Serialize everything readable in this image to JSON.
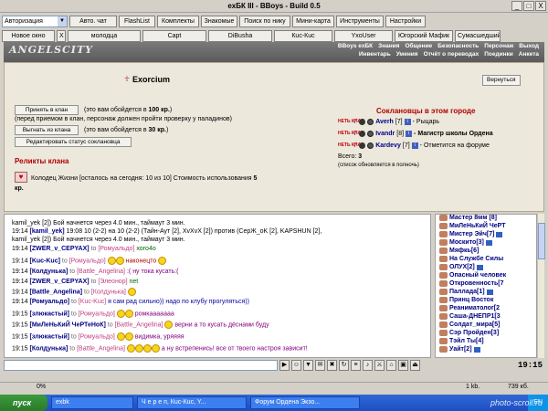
{
  "window": {
    "title": "exБК III - BBoys - Build 0.5",
    "btn_min": "_",
    "btn_max": "□",
    "btn_close": "X"
  },
  "toolbar1": {
    "dropdown_value": "Авторизация",
    "buttons": [
      "Авто. чат",
      "FlashList",
      "Комплекты",
      "Знакомые",
      "Поиск по нику",
      "Мини-карта",
      "Инструменты",
      "Настройки"
    ]
  },
  "toolbar2": {
    "new_window": "Новое окно",
    "close": "X",
    "tabs": [
      "молодца",
      "Capt",
      "DiBusha",
      "Кuc-Кuc",
      "YxoUser",
      "Югорский Мафик",
      "Сумасшедший"
    ]
  },
  "game_header": {
    "logo": "ANGELSCITY",
    "menu_row1": [
      "BBoys exБК",
      "Знания",
      "Общение",
      "Безопасность",
      "Персонаж",
      "Выход"
    ],
    "menu_row2": [
      "Инвентарь",
      "Умения",
      "Отчёт о переводах",
      "Поединки",
      "Анкета"
    ]
  },
  "clan": {
    "name": "Exorcium",
    "return_label": "Вернуться",
    "accept_button": "Принять в клан",
    "accept_cost_pre": "(это вам обойдется в ",
    "accept_cost": "100 кр.",
    "accept_cost_post": ")",
    "accept_note": "(перед приемом в клан, персонаж должен пройти проверку у паладинов)",
    "expel_button": "Выгнать из клана",
    "expel_cost_pre": "(это вам обойдется в ",
    "expel_cost": "30 кр.",
    "expel_cost_post": ")",
    "edit_status_button": "Редактировать статус соклановца",
    "relics_title": "Реликты клана",
    "relic_text": "Колодец Жизни [осталось на сегодня: 10 из 10] Стоимость использования ",
    "relic_cost": "5",
    "relic_cost_unit": "кр.",
    "members_title": "Соклановцы в этом городе",
    "badge_text": "НЕТЬ КЛАН",
    "members": [
      {
        "nick": "Averh",
        "level": "[7]",
        "status": "- Рыцарь"
      },
      {
        "nick": "Ivandr",
        "level": "[8]",
        "status": "- Магистр школы Ордена"
      },
      {
        "nick": "Kardevy",
        "level": "[7]",
        "status": "- Отметится на форуме"
      }
    ],
    "total_label": "Всего: ",
    "total_value": "3",
    "list_note": "(список обновляется в полночь)"
  },
  "chat": {
    "lines": [
      {
        "text": "kamil_yek [2]) Бой начнется через 4.0 мин., таймаут 3 мин."
      },
      {
        "time": "19:14",
        "nick": "[kamil_yek]",
        "text": "19:08 10 (2-2) на 10 (2-2) (Тайн-Аут [2], XvXvX [2]) против (СерЖ_oK [2], KAPSHUN [2],"
      },
      {
        "text": "kamil_yek [2]) Бой начнется через 4.0 мин., таймаут 3 мин."
      },
      {
        "time": "19:14",
        "nick": "[ZWER_v_CEPYAX]",
        "to": "to",
        "target": "[Ромуальдо]",
        "msg": "хого4о"
      },
      {
        "time": "19:14",
        "nick": "[Kuc-Kuc]",
        "to": "to",
        "target": "[Ромуальдо]",
        "msg": "наконецто"
      },
      {
        "time": "19:14",
        "nick": "[Колдунька]",
        "to": "to",
        "target": "[Battle_Angelina]",
        "msg": ":( ну тока кусать:("
      },
      {
        "time": "19:14",
        "nick": "[ZWER_v_CEPYAX]",
        "to": "to",
        "target": "[Элеонор]",
        "msg": "net"
      },
      {
        "time": "19:14",
        "nick": "[Battle_Angelina]",
        "to": "to",
        "target": "[Колдунька]",
        "msg": ""
      },
      {
        "time": "19:14",
        "nick": "[Ромуальдо]",
        "to": "to",
        "target": "[Kuc-Kuc]",
        "msg": "я сам рад сильно)) надо по клубу прогуляться))"
      },
      {
        "time": "19:15",
        "nick": "[злюкастый]",
        "to": "to",
        "target": "[Ромуальдо]",
        "msg": "ромкааааааа"
      },
      {
        "time": "19:15",
        "nick": "[МиЛеНьКиЙ ЧеРТеНоК]",
        "to": "to",
        "target": "[Battle_Angelina]",
        "msg": "верни а то кусать дёснами буду"
      },
      {
        "time": "19:15",
        "nick": "[злюкастый]",
        "to": "to",
        "target": "[Ромуальдо]",
        "msg": "видимка, уряяяя"
      },
      {
        "time": "19:15",
        "nick": "[Колдунька]",
        "to": "to",
        "target": "[Battle_Angelina]",
        "msg": "а ну встрепенись! все от твоего настроя зависит!"
      }
    ]
  },
  "userlist": [
    {
      "name": "Мастер 8мм [8]"
    },
    {
      "name": "МиЛеНьКиЙ ЧеРТ"
    },
    {
      "name": "Мистер Эйч[7]"
    },
    {
      "name": "Москито[3]"
    },
    {
      "name": "Мяфкь[6]"
    },
    {
      "name": "На Службе Силы"
    },
    {
      "name": "ОЛУХ[2]"
    },
    {
      "name": "Опасный человек"
    },
    {
      "name": "Откровенность[7"
    },
    {
      "name": "Паллада[1]"
    },
    {
      "name": "Принц Восток"
    },
    {
      "name": "Реаниматолог[2"
    },
    {
      "name": "Саша-ДНЕПР1[3"
    },
    {
      "name": "Солдат_мира[5]"
    },
    {
      "name": "Сэр Пройден[3]"
    },
    {
      "name": "Тэйл Ты[4]"
    },
    {
      "name": "Уайт[2]"
    }
  ],
  "inputbar": {
    "value": "",
    "clock": "19:15"
  },
  "statusbar": {
    "percent": "0%",
    "size": "1 kb.",
    "size2": "739 кб."
  },
  "taskbar": {
    "start": "пуск",
    "tasks": [
      "exbk",
      "Ч е р е п, Кuc-Кuc, Y...",
      "Форум Ордена Экзо..."
    ],
    "tray": "EN"
  },
  "watermark": "photo-scroll.ru",
  "colors": {
    "accent_red": "#b00000",
    "nick_blue": "#000080",
    "taskbar": "#2a5fd0",
    "start_green": "#2f8a2f"
  }
}
